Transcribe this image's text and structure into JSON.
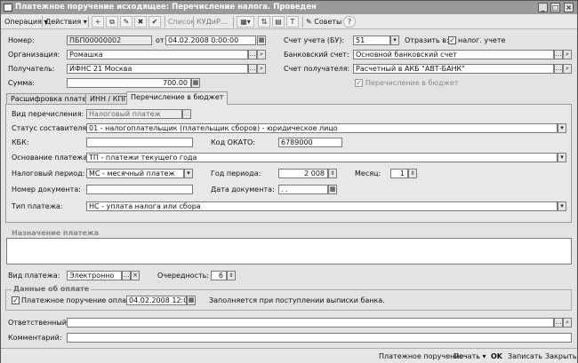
{
  "window": {
    "title": "Платежное поручение исходящее: Перечисление налога. Проведен"
  },
  "toolbar": {
    "operation": "Операция",
    "actions": "Действия",
    "list": "Список",
    "kudir": "КУДиР...",
    "advice": "Советы"
  },
  "header": {
    "number_label": "Номер:",
    "number": "ПБП00000002",
    "date_label": "от",
    "date": "04.02.2008  0:00:00",
    "account_label": "Счет учета (БУ):",
    "account": "51",
    "reflect_label": "Отразить в:",
    "tax_acc_label": "налог. учете",
    "org_label": "Организация:",
    "org": "Ромашка",
    "bank_label": "Банковский счет:",
    "bank": "Основной банковский счет",
    "recipient_label": "Получатель:",
    "recipient": "ИФНС 21 Москва",
    "recip_acc_label": "Счет получателя:",
    "recip_acc": "Расчетный в АКБ \"АВТ-БАНК\"",
    "sum_label": "Сумма:",
    "sum": "700.00",
    "budget_label": "Перечисление в бюджет"
  },
  "tabs": [
    "Расшифровка платежа",
    "ИНН / КПП",
    "Перечисление в бюджет"
  ],
  "budget": {
    "kind_label": "Вид перечисления:",
    "kind": "Налоговый платеж",
    "status_label": "Статус составителя:",
    "status": "01 - налогоплательщик (плательщик сборов) - юридическое лицо",
    "kbk_label": "КБК:",
    "kbk": "",
    "okato_label": "Код ОКАТО:",
    "okato": "6789000",
    "basis_label": "Основание платежа:",
    "basis": "ТП - платежи текущего года",
    "period_label": "Налоговый период:",
    "period": "МС - месячный платеж",
    "year_label": "Год периода:",
    "year": "2 008",
    "month_label": "Месяц:",
    "month": "1",
    "docnum_label": "Номер документа:",
    "docnum": "",
    "docdate_label": "Дата документа:",
    "docdate": " .  .",
    "paytype_label": "Тип платежа:",
    "paytype": "НС - уплата налога или сбора"
  },
  "purpose": {
    "label": "Назначение платежа",
    "value": ""
  },
  "payment": {
    "kind_label": "Вид платежа:",
    "kind": "Электронно",
    "order_label": "Очередность:",
    "order": "6"
  },
  "paid": {
    "group_label": "Данные об оплате",
    "paid_label": "Платежное поручение оплачено:",
    "paid_date": "04.02.2008 12:00:01",
    "note": "Заполняется при поступлении выписки банка."
  },
  "footer": {
    "resp_label": "Ответственный:",
    "resp": "",
    "comment_label": "Комментарий:",
    "comment": ""
  },
  "buttons": {
    "doc": "Платежное поручение",
    "print": "Печать",
    "ok": "OK",
    "save": "Записать",
    "close": "Закрыть"
  }
}
